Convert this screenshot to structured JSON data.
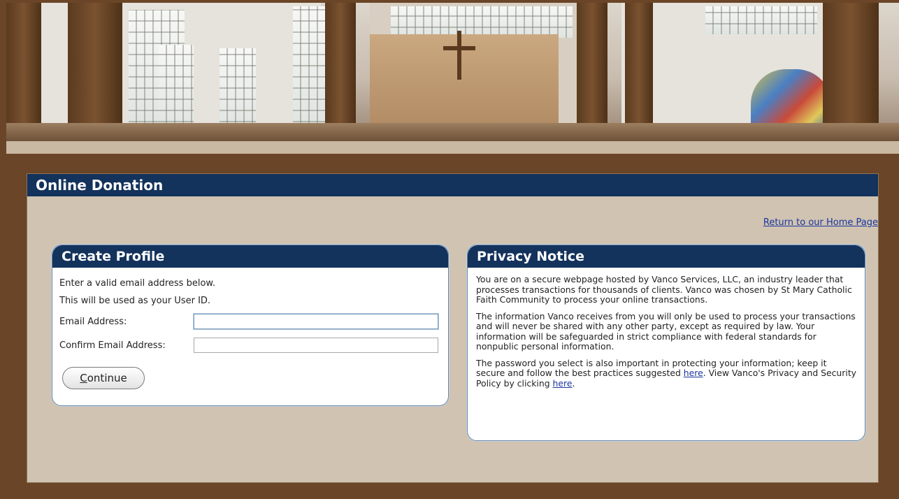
{
  "banner": {
    "image": "church-interior-photo"
  },
  "panel": {
    "title": "Online Donation",
    "home_link": "Return to our Home Page"
  },
  "create_profile": {
    "title": "Create Profile",
    "instruction_1": "Enter a valid email address below.",
    "instruction_2": "This will be used as your User ID.",
    "email_label": "Email Address:",
    "email_value": "",
    "confirm_label": "Confirm Email Address:",
    "confirm_value": "",
    "continue_first": "C",
    "continue_rest": "ontinue"
  },
  "privacy": {
    "title": "Privacy Notice",
    "para1": "You are on a secure webpage hosted by Vanco Services, LLC, an industry leader that processes transactions for thousands of clients. Vanco was chosen by St Mary Catholic Faith Community to process your online transactions.",
    "para2": "The information Vanco receives from you will only be used to process your transactions and will never be shared with any other party, except as required by law. Your information will be safeguarded in strict compliance with federal standards for nonpublic personal information.",
    "para3_a": "The password you select is also important in protecting your information; keep it secure and follow the best practices suggested ",
    "link_here_1": "here",
    "para3_b": ". View Vanco's Privacy and Security Policy by clicking ",
    "link_here_2": "here",
    "para3_c": "."
  },
  "colors": {
    "header": "#13325c",
    "panel": "#d0c3b1",
    "frame": "#6b4527",
    "link": "#1a35a0"
  }
}
